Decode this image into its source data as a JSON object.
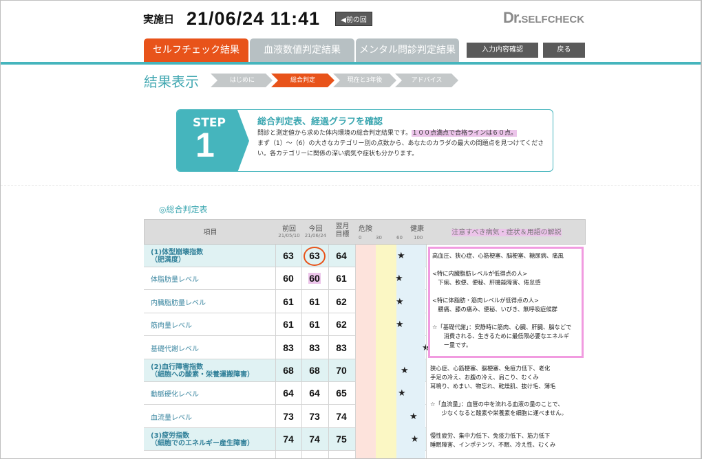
{
  "header": {
    "date_label": "実施日",
    "datetime": "21/06/24 11:41",
    "prev_button": "◀前の回",
    "logo_dr": "Dr.",
    "logo_rest": "SELFCHECK"
  },
  "tabs": [
    {
      "label": "セルフチェック結果",
      "active": true
    },
    {
      "label": "血液数値判定結果",
      "active": false
    },
    {
      "label": "メンタル問診判定結果",
      "active": false
    }
  ],
  "buttons": {
    "input_check": "入力内容確認",
    "back": "戻る"
  },
  "page_title": "結果表示",
  "steps": [
    {
      "label": "はじめに",
      "active": false
    },
    {
      "label": "総合判定",
      "active": true
    },
    {
      "label": "現在と3年後",
      "active": false
    },
    {
      "label": "アドバイス",
      "active": false
    }
  ],
  "step": {
    "word": "STEP",
    "number": "1",
    "title": "総合判定表、経過グラフを確認",
    "desc_a": "問診と測定値から求めた体内環境の総合判定結果です。",
    "desc_highlight": "１００点満点で合格ラインは６０点。",
    "desc_b": "まず（1）～（6）の大きなカテゴリー別の点数から、あなたのカラダの最大の問題点を見つけてください。各カテゴリーに関係の深い病気や症状も分かります。"
  },
  "section_title": "◎総合判定表",
  "table": {
    "headers": {
      "item": "項目",
      "prev": "前回",
      "prev_date": "21/05/10",
      "curr": "今回",
      "curr_date": "21/06/24",
      "goal": "翌月",
      "goal2": "目標",
      "danger": "危険",
      "health": "健康",
      "notes": "注意すべき病気・症状＆用語の解説"
    },
    "scale_ticks": [
      "0",
      "30",
      "60",
      "100"
    ],
    "rows": [
      {
        "name": "(1)体型崩壊指数",
        "name2": "（肥満度）",
        "main": true,
        "prev": "63",
        "curr": "63",
        "goal": "64",
        "score": 63
      },
      {
        "name": "体脂肪量レベル",
        "main": false,
        "prev": "60",
        "curr": "60",
        "goal": "61",
        "score": 60
      },
      {
        "name": "内臓脂肪量レベル",
        "main": false,
        "prev": "61",
        "curr": "61",
        "goal": "62",
        "score": 61
      },
      {
        "name": "筋肉量レベル",
        "main": false,
        "prev": "61",
        "curr": "61",
        "goal": "62",
        "score": 61
      },
      {
        "name": "基礎代謝レベル",
        "main": false,
        "prev": "83",
        "curr": "83",
        "goal": "83",
        "score": 83
      },
      {
        "name": "(2)血行障害指数",
        "name2": "（細胞への酸素・栄養運搬障害）",
        "main": true,
        "prev": "68",
        "curr": "68",
        "goal": "70",
        "score": 68
      },
      {
        "name": "動脈硬化レベル",
        "main": false,
        "prev": "64",
        "curr": "64",
        "goal": "65",
        "score": 64
      },
      {
        "name": "血流量レベル",
        "main": false,
        "prev": "73",
        "curr": "73",
        "goal": "74",
        "score": 73
      },
      {
        "name": "(3)疲労指数",
        "name2": "（細胞でのエネルギー産生障害）",
        "main": true,
        "prev": "74",
        "curr": "74",
        "goal": "75",
        "score": 74
      }
    ],
    "star": "★",
    "notes1": [
      "高血圧、狭心症、心筋梗塞、脳梗塞、糖尿病、痛風",
      "",
      "<特に内臓脂肪レベルが低得点の人>",
      "　下痢、軟便、便秘、肝機能障害、倦怠感",
      "",
      "<特に体脂肪・筋肉レベルが低得点の人>",
      "　腰痛、膝の痛み、便秘、いびき、無呼吸症候群",
      "",
      "☆「基礎代謝」：安静時に筋肉、心臓、肝臓、脳などで",
      "　　消費される、生きるために最低限必要なエネルギ",
      "　　ー量です。"
    ],
    "notes2": [
      "狭心症、心筋梗塞、脳梗塞、免疫力低下、老化",
      "手足の冷え、お腹の冷え、肩こり、むくみ",
      "耳鳴り、めまい、物忘れ、乾燥肌、抜け毛、薄毛",
      "",
      "☆「血流量」：血管の中を流れる血液の量のことで、",
      "　　少なくなると酸素や栄養素を細胞に運べません。"
    ],
    "notes3": [
      "慢性疲労、集中力低下、免疫力低下、筋力低下",
      "睡眠障害、インポテンツ、不眠、冷え性、むくみ"
    ]
  },
  "colors": {
    "accent": "#e8531a",
    "teal": "#45b5bd",
    "highlight": "#ecc4ea",
    "pink_border": "#f19be0"
  }
}
